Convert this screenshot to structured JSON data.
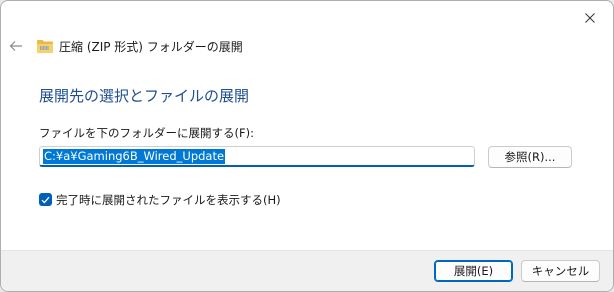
{
  "window": {
    "title": "圧縮 (ZIP 形式) フォルダーの展開",
    "close_icon": "close-icon",
    "back_icon": "arrow-left-icon",
    "folder_icon": "zip-folder-icon"
  },
  "main": {
    "heading": "展開先の選択とファイルの展開",
    "dest_label": "ファイルを下のフォルダーに展開する(F):",
    "dest_value": "C:¥a¥Gaming6B_Wired_Update",
    "browse_label": "参照(R)...",
    "checkbox_label": "完了時に展開されたファイルを表示する(H)",
    "checkbox_checked": true
  },
  "footer": {
    "ok_label": "展開(E)",
    "cancel_label": "キャンセル"
  },
  "colors": {
    "accent": "#005fb8",
    "heading": "#1d4f91",
    "selection": "#0078d4"
  }
}
